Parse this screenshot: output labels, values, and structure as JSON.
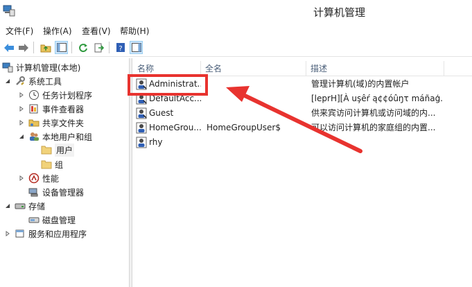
{
  "window": {
    "title": "计算机管理"
  },
  "menu": {
    "items": [
      "文件(F)",
      "操作(A)",
      "查看(V)",
      "帮助(H)"
    ]
  },
  "tree": {
    "nodes": [
      {
        "label": "计算机管理(本地)"
      },
      {
        "label": "系统工具"
      },
      {
        "label": "任务计划程序"
      },
      {
        "label": "事件查看器"
      },
      {
        "label": "共享文件夹"
      },
      {
        "label": "本地用户和组"
      },
      {
        "label": "用户"
      },
      {
        "label": "组"
      },
      {
        "label": "性能"
      },
      {
        "label": "设备管理器"
      },
      {
        "label": "存储"
      },
      {
        "label": "磁盘管理"
      },
      {
        "label": "服务和应用程序"
      }
    ]
  },
  "list": {
    "columns": [
      "名称",
      "全名",
      "描述"
    ],
    "rows": [
      {
        "name": "Administrat...",
        "fullname": "",
        "desc": "管理计算机(域)的内置帐户"
      },
      {
        "name": "DefaultAcc...",
        "fullname": "",
        "desc": "[leprH][À uşêŕ ą¢¢óûŋτ máñaģ..."
      },
      {
        "name": "Guest",
        "fullname": "",
        "desc": "供来宾访问计算机或访问域的内..."
      },
      {
        "name": "HomeGrou...",
        "fullname": "HomeGroupUser$",
        "desc": "可以访问计算机的家庭组的内置..."
      },
      {
        "name": "rhy",
        "fullname": "",
        "desc": ""
      }
    ]
  },
  "annotation": {
    "highlight_color": "#e8332f"
  }
}
